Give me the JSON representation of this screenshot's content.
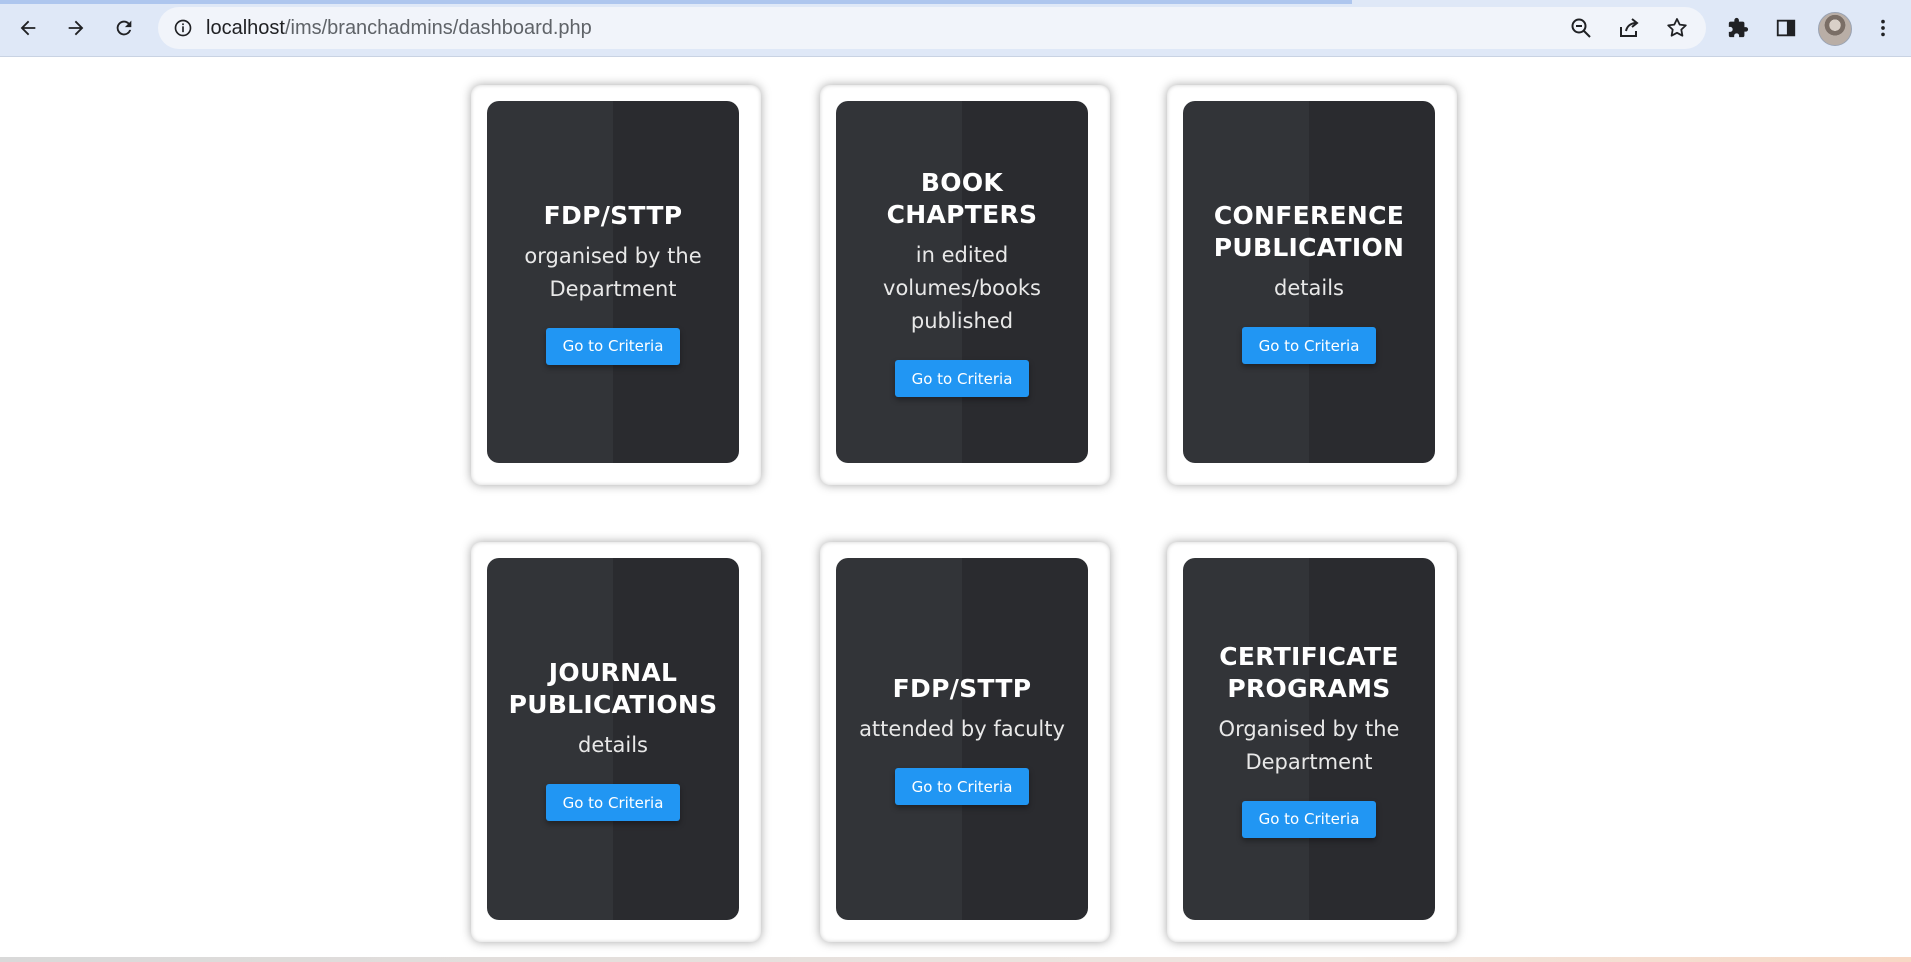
{
  "browser": {
    "url_host": "localhost",
    "url_path": "/ims/branchadmins/dashboard.php",
    "icons": [
      "back-icon",
      "forward-icon",
      "reload-icon",
      "info-icon",
      "zoom-out-icon",
      "share-icon",
      "star-icon",
      "extensions-icon",
      "side-panel-icon",
      "profile-avatar",
      "menu-icon"
    ]
  },
  "cards": [
    {
      "title": "FDP/STTP",
      "subtitle": "organised by the Department",
      "button": "Go to Criteria"
    },
    {
      "title": "BOOK CHAPTERS",
      "subtitle": "in edited volumes/books published",
      "button": "Go to Criteria"
    },
    {
      "title": "CONFERENCE PUBLICATION",
      "subtitle": "details",
      "button": "Go to Criteria"
    },
    {
      "title": "JOURNAL PUBLICATIONS",
      "subtitle": "details",
      "button": "Go to Criteria"
    },
    {
      "title": "FDP/STTP",
      "subtitle": "attended by faculty",
      "button": "Go to Criteria"
    },
    {
      "title": "CERTIFICATE PROGRAMS",
      "subtitle": "Organised by the Department",
      "button": "Go to Criteria"
    }
  ],
  "colors": {
    "card_bg": "#323438",
    "button": "#2196f3",
    "chrome": "#dfe8f7"
  }
}
